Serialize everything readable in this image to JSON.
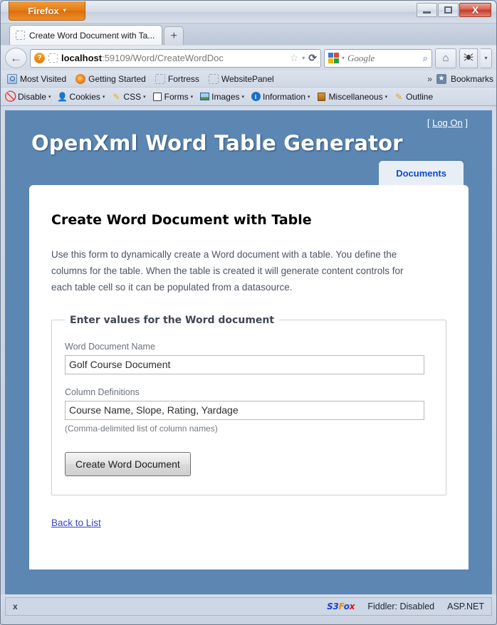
{
  "browser": {
    "app_button": "Firefox",
    "app_button_caret": "▾",
    "window_controls": {
      "minimize": "minimize-icon",
      "maximize": "maximize-icon",
      "close": "X"
    },
    "tab": {
      "title": "Create Word Document with Ta...",
      "favicon": "blank-favicon-icon",
      "new_tab_label": "+"
    },
    "toolbar": {
      "back": "←",
      "url_host": "localhost",
      "url_rest": ":59109/Word/CreateWordDoc",
      "url_full": "localhost:59109/Word/CreateWordDoc",
      "identity_icon": "?",
      "bookmark_star": "☆",
      "star_caret": "▾",
      "reload": "⟳",
      "search_engine": "google-icon",
      "search_placeholder": "Google",
      "search_value": "",
      "search_caret": "▾",
      "magnifier": "⌕",
      "home": "⌂",
      "devtool_caret": "▾"
    },
    "bookmarks_bar": {
      "items": [
        {
          "label": "Most Visited",
          "icon": "most-visited-icon"
        },
        {
          "label": "Getting Started",
          "icon": "firefox-icon"
        },
        {
          "label": "Fortress",
          "icon": "blank-favicon-icon"
        },
        {
          "label": "WebsitePanel",
          "icon": "blank-favicon-icon"
        }
      ],
      "overflow": "»",
      "bookmarks_label": "Bookmarks",
      "bookmarks_icon": "star-folder-icon"
    },
    "webdev_bar": {
      "items": [
        {
          "label": "Disable",
          "icon": "disable-icon",
          "caret": "▾"
        },
        {
          "label": "Cookies",
          "icon": "cookie-icon",
          "caret": "▾"
        },
        {
          "label": "CSS",
          "icon": "css-pencil-icon",
          "caret": "▾"
        },
        {
          "label": "Forms",
          "icon": "forms-icon",
          "caret": "▾"
        },
        {
          "label": "Images",
          "icon": "images-icon",
          "caret": "▾"
        },
        {
          "label": "Information",
          "icon": "information-icon",
          "caret": "▾"
        },
        {
          "label": "Miscellaneous",
          "icon": "miscellaneous-icon",
          "caret": "▾"
        },
        {
          "label": "Outline",
          "icon": "outline-pencil-icon",
          "caret": ""
        }
      ]
    },
    "status_bar": {
      "close_label": "x",
      "s3fox": {
        "part1": "S3",
        "part2": "F",
        "part3": "o",
        "part4": "x"
      },
      "fiddler": "Fiddler: Disabled",
      "aspnet": "ASP.NET"
    }
  },
  "page": {
    "login_open_bracket": "[",
    "login_label": "Log On",
    "login_close_bracket": "]",
    "site_title": "OpenXml Word Table Generator",
    "menu": {
      "tabs": [
        {
          "label": "Documents",
          "selected": true
        }
      ]
    },
    "heading": "Create Word Document with Table",
    "intro": "Use this form to dynamically create a Word document with a table. You define the columns for the table. When the table is created it will generate content controls for each table cell so it can be populated from a datasource.",
    "form": {
      "legend": "Enter values for the Word document",
      "fields": [
        {
          "label": "Word Document Name",
          "value": "Golf Course Document",
          "placeholder": "",
          "hint": ""
        },
        {
          "label": "Column Definitions",
          "value": "Course Name, Slope, Rating, Yardage",
          "placeholder": "",
          "hint": "(Comma-delimited list of column names)"
        }
      ],
      "submit_label": "Create Word Document"
    },
    "back_link": "Back to List"
  },
  "colors": {
    "page_background": "#5c87b2",
    "content_background": "#ffffff",
    "tab_text": "#0e4ad0",
    "link": "#3a45c8",
    "firefox_orange": "#e37a16"
  }
}
